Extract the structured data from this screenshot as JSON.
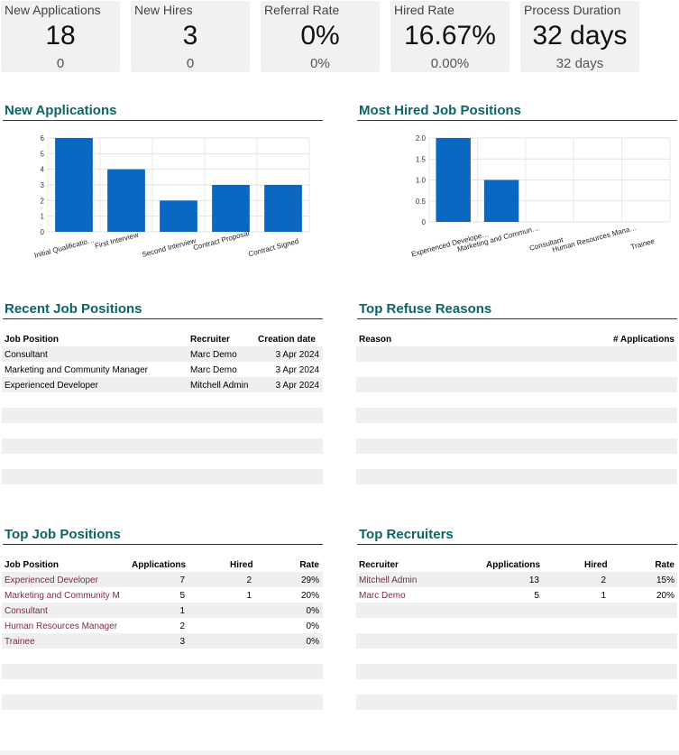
{
  "kpis": [
    {
      "title": "New Applications",
      "value": "18",
      "sub": "0"
    },
    {
      "title": "New Hires",
      "value": "3",
      "sub": "0"
    },
    {
      "title": "Referral Rate",
      "value": "0%",
      "sub": "0%"
    },
    {
      "title": "Hired Rate",
      "value": "16.67%",
      "sub": "0.00%"
    },
    {
      "title": "Process Duration",
      "value": "32 days",
      "sub": "32 days"
    }
  ],
  "sections": {
    "new_applications": "New Applications",
    "most_hired": "Most Hired Job Positions",
    "recent_jobs": "Recent Job Positions",
    "refuse_reasons": "Top Refuse Reasons",
    "top_jobs": "Top Job Positions",
    "top_recruiters": "Top Recruiters"
  },
  "chart_data": [
    {
      "type": "bar",
      "categories": [
        "Initial Qualificatio…",
        "First Interview",
        "Second Interview",
        "Contract Proposal",
        "Contract Signed"
      ],
      "values": [
        6,
        4,
        2,
        3,
        3
      ],
      "ylim": [
        0,
        6
      ],
      "yticks": [
        "0",
        "1",
        "2",
        "3",
        "4",
        "5",
        "6"
      ],
      "color": "#0a67c2",
      "grid": true
    },
    {
      "type": "bar",
      "categories": [
        "Experienced Develope…",
        "Marketing and Commun…",
        "Consultant",
        "Human Resources Mana…",
        "Trainee"
      ],
      "values": [
        2,
        1,
        0,
        0,
        0
      ],
      "ylim": [
        0,
        2
      ],
      "yticks": [
        "0",
        "0.5",
        "1.0",
        "1.5",
        "2.0"
      ],
      "color": "#0a67c2",
      "grid": true
    }
  ],
  "recent_jobs": {
    "headers": [
      "Job Position",
      "Recruiter",
      "Creation date"
    ],
    "rows": [
      [
        "Consultant",
        "Marc Demo",
        "3 Apr 2024"
      ],
      [
        "Marketing and Community Manager",
        "Marc Demo",
        "3 Apr 2024"
      ],
      [
        "Experienced Developer",
        "Mitchell Admin",
        "3 Apr 2024"
      ]
    ]
  },
  "refuse_reasons": {
    "headers": [
      "Reason",
      "# Applications"
    ]
  },
  "top_jobs": {
    "headers": [
      "Job Position",
      "Applications",
      "Hired",
      "Rate"
    ],
    "rows": [
      [
        "Experienced Developer",
        "7",
        "2",
        "29%"
      ],
      [
        "Marketing and Community Ma",
        "5",
        "1",
        "20%"
      ],
      [
        "Consultant",
        "1",
        "",
        "0%"
      ],
      [
        "Human Resources Manager",
        "2",
        "",
        "0%"
      ],
      [
        "Trainee",
        "3",
        "",
        "0%"
      ]
    ]
  },
  "top_recruiters": {
    "headers": [
      "Recruiter",
      "Applications",
      "Hired",
      "Rate"
    ],
    "rows": [
      [
        "Mitchell Admin",
        "13",
        "2",
        "15%"
      ],
      [
        "Marc Demo",
        "5",
        "1",
        "20%"
      ]
    ]
  }
}
